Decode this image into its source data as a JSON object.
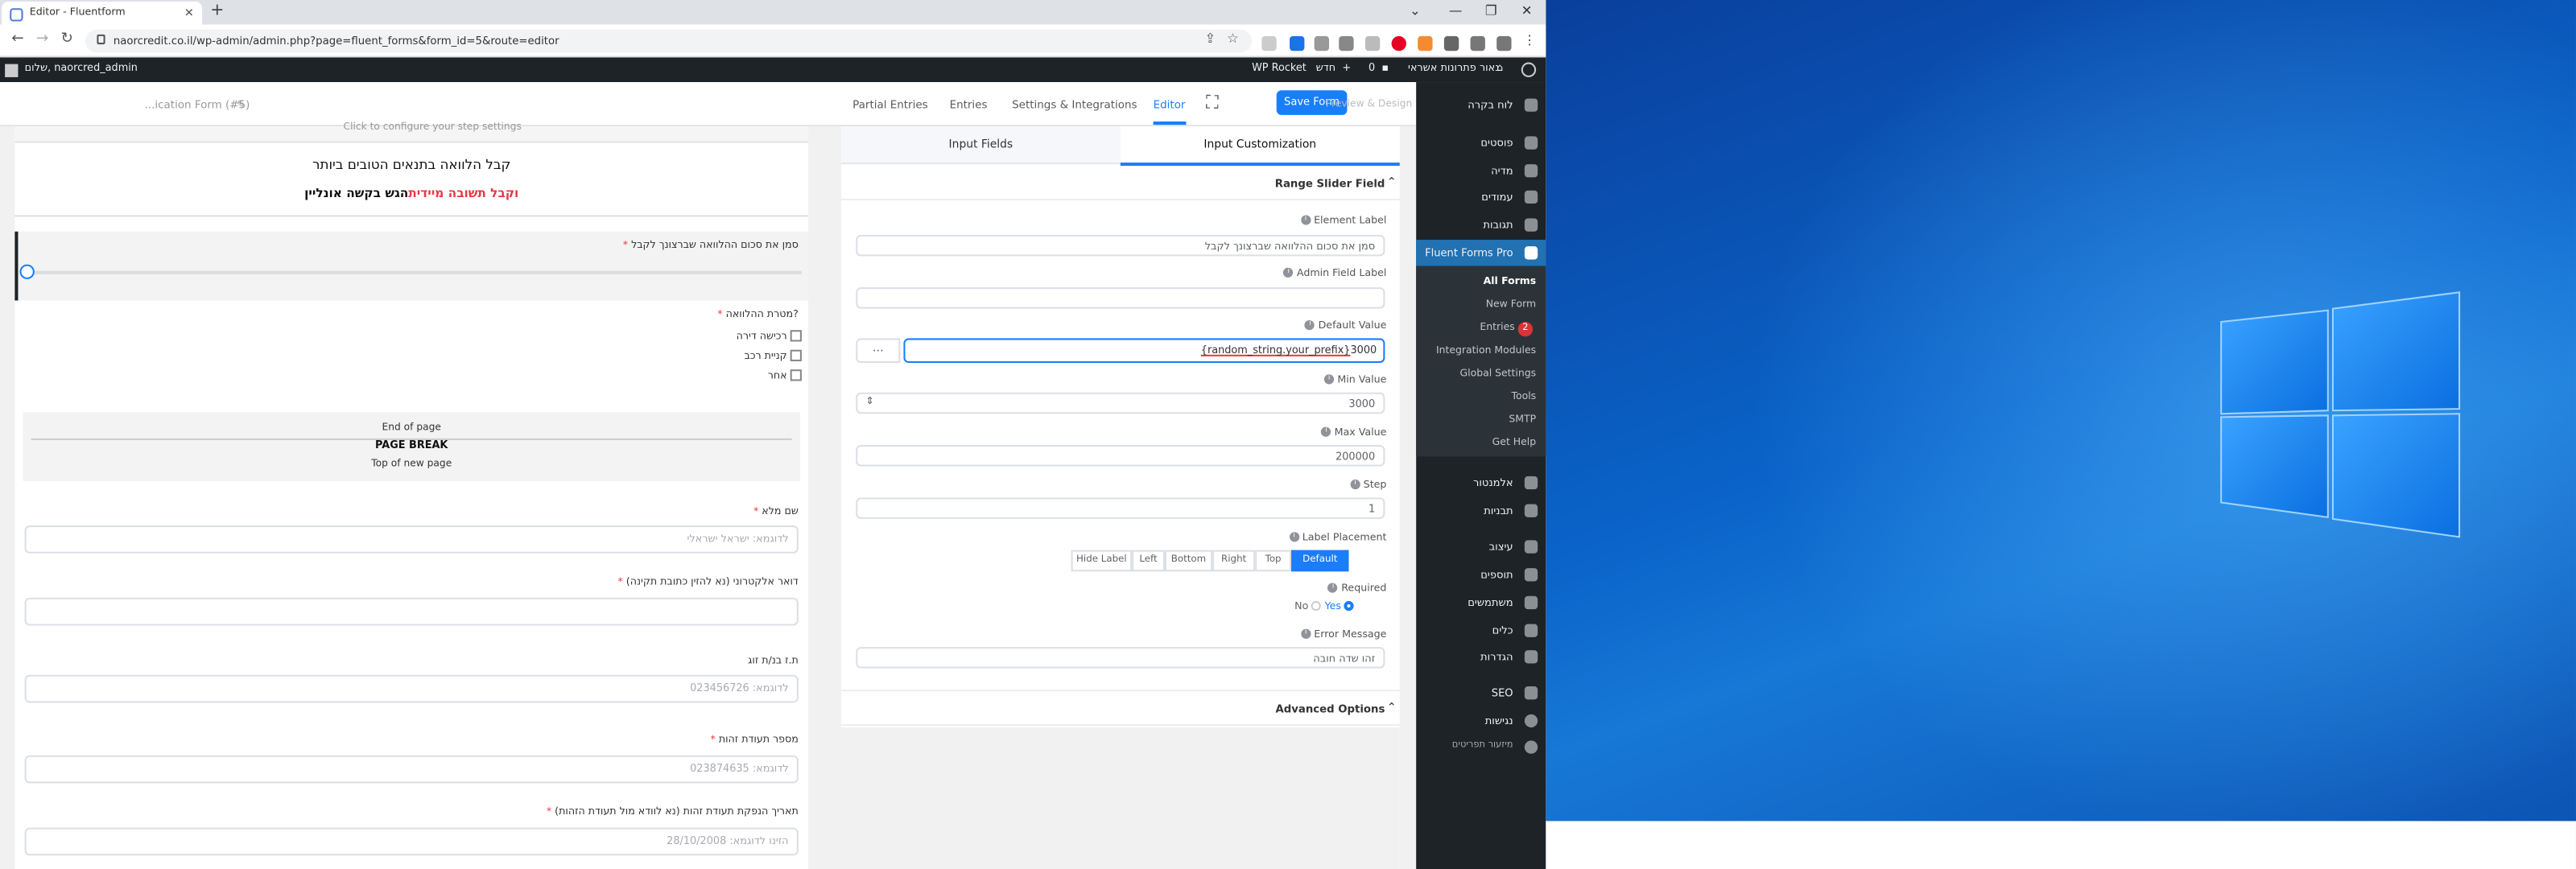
{
  "browser": {
    "tab_title": "Editor - Fluentform",
    "url": "naorcredit.co.il/wp-admin/admin.php?page=fluent_forms&form_id=5&route=editor"
  },
  "wp_admin_bar": {
    "greeting": "שלום, naorcred_admin",
    "wp_rocket": "WP Rocket",
    "new_label": "חדש",
    "comments_count": "0",
    "site_name": "נאור פתרונות אשראי"
  },
  "admin_menu": {
    "items": [
      {
        "label": "לוח בקרה"
      },
      {
        "label": "פוסטים"
      },
      {
        "label": "מדיה"
      },
      {
        "label": "עמודים"
      },
      {
        "label": "תגובות"
      },
      {
        "label": "Fluent Forms Pro"
      },
      {
        "label": "אלמנטור"
      },
      {
        "label": "תבניות"
      },
      {
        "label": "עיצוב"
      },
      {
        "label": "תוספים"
      },
      {
        "label": "משתמשים"
      },
      {
        "label": "כלים"
      },
      {
        "label": "הגדרות"
      },
      {
        "label": "SEO"
      },
      {
        "label": "נגישות"
      },
      {
        "label": "מיזעור תפריטים"
      }
    ],
    "submenu": [
      "All Forms",
      "New Form",
      "Entries",
      "Integration Modules",
      "Global Settings",
      "Tools",
      "SMTP",
      "Get Help"
    ],
    "entries_badge": "2"
  },
  "editor_nav": {
    "form_title": "...ication Form (#5)",
    "partial_entries": "Partial Entries",
    "entries": "Entries",
    "settings": "Settings & Integrations",
    "editor": "Editor",
    "save": "Save Form",
    "preview": "Preview & Design"
  },
  "canvas": {
    "step_hint": "Click to configure your step settings",
    "heading": "קבל הלוואה בתנאים הטובים ביותר",
    "subheading_black": "הגש בקשה אונליין",
    "subheading_red": " וקבל תשובה מיידית",
    "range_label": "סמן את סכום ההלוואה שברצונך לקבל",
    "purpose_label": "מטרת ההלוואה?",
    "purpose_options": [
      "רכישה דירה",
      "קניית רכב",
      "אחר"
    ],
    "page_break": {
      "end": "End of page",
      "title": "PAGE BREAK",
      "top": "Top of new page"
    },
    "fields": [
      {
        "label": "שם מלא",
        "required": true,
        "placeholder": "לדוגמא: ישראל ישראלי"
      },
      {
        "label": "דואר אלקטרוני (נא להזין כתובת תקינה)",
        "required": true,
        "placeholder": ""
      },
      {
        "label": "ת.ז בנ/ת זוג",
        "required": false,
        "placeholder": "לדוגמא: 023456726"
      },
      {
        "label": "מספר תעודת זהות",
        "required": true,
        "placeholder": "לדוגמא: 023874635"
      },
      {
        "label": "תאריך הנפקת תעודת זהות (נא לוודא מול תעודת הזהות)",
        "required": true,
        "placeholder": "הזינו לדוגמא: 28/10/2008"
      }
    ]
  },
  "panel": {
    "tab_input_fields": "Input Fields",
    "tab_customization": "Input Customization",
    "section_title": "Range Slider Field",
    "element_label_title": "Element Label",
    "element_label_value": "סמן את סכום ההלוואה שברצונך לקבל",
    "admin_label_title": "Admin Field Label",
    "admin_label_value": "",
    "default_value_title": "Default Value",
    "default_value_prefix": "{random_string.your_prefix}",
    "default_value_number": "3000",
    "min_title": "Min Value",
    "min_value": "3000",
    "max_title": "Max Value",
    "max_value": "200000",
    "step_title": "Step",
    "step_value": "1",
    "placement_title": "Label Placement",
    "placement_options": [
      "Hide Label",
      "Left",
      "Bottom",
      "Right",
      "Top",
      "Default"
    ],
    "placement_selected": "Default",
    "required_title": "Required",
    "required_no": "No",
    "required_yes": "Yes",
    "error_title": "Error Message",
    "error_value": "זהו שדה חובה",
    "advanced": "Advanced Options",
    "ellipsis": "..."
  },
  "colors": {
    "accent": "#1a7efb",
    "wp_dark": "#1d2327",
    "wp_active": "#2271b1",
    "red": "#e63946"
  }
}
